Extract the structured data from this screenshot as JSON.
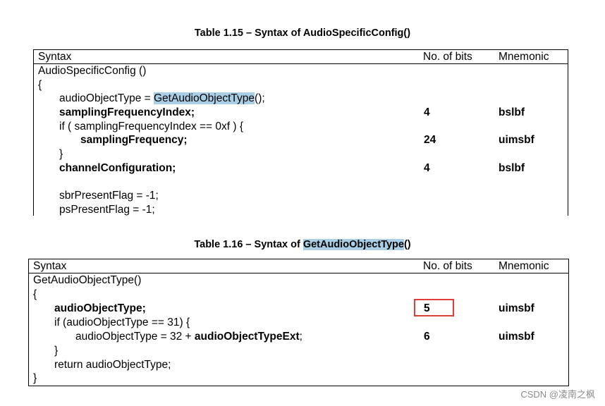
{
  "table1": {
    "caption": "Table 1.15 – Syntax of AudioSpecificConfig()",
    "headers": [
      "Syntax",
      "No. of bits",
      "Mnemonic"
    ],
    "rows": [
      {
        "syntax": "AudioSpecificConfig ()",
        "bits": "",
        "mnemonic": "",
        "bold": false
      },
      {
        "syntax": "{",
        "bits": "",
        "mnemonic": "",
        "bold": false
      },
      {
        "syntax_pre": "audioObjectType = ",
        "syntax_hl": "GetAudioObjectType",
        "syntax_post": "();",
        "bits": "",
        "mnemonic": "",
        "bold": false
      },
      {
        "syntax": "samplingFrequencyIndex;",
        "bits": "4",
        "mnemonic": "bslbf",
        "bold": true
      },
      {
        "syntax": "if ( samplingFrequencyIndex == 0xf ) {",
        "bits": "",
        "mnemonic": "",
        "bold": false
      },
      {
        "syntax": "samplingFrequency;",
        "bits": "24",
        "mnemonic": "uimsbf",
        "bold": true
      },
      {
        "syntax": "}",
        "bits": "",
        "mnemonic": "",
        "bold": false
      },
      {
        "syntax": "channelConfiguration;",
        "bits": "4",
        "mnemonic": "bslbf",
        "bold": true
      },
      {
        "syntax": "",
        "bits": "",
        "mnemonic": "",
        "bold": false
      },
      {
        "syntax": "sbrPresentFlag = -1;",
        "bits": "",
        "mnemonic": "",
        "bold": false
      },
      {
        "syntax": "psPresentFlag = -1;",
        "bits": "",
        "mnemonic": "",
        "bold": false
      }
    ]
  },
  "table2": {
    "caption_pre": "Table 1.16 – Syntax of ",
    "caption_hl": "GetAudioObjectType",
    "caption_post": "()",
    "headers": [
      "Syntax",
      "No. of bits",
      "Mnemonic"
    ],
    "rows": [
      {
        "syntax": "GetAudioObjectType()",
        "bits": "",
        "mnemonic": "",
        "bold": false
      },
      {
        "syntax": "{",
        "bits": "",
        "mnemonic": "",
        "bold": false
      },
      {
        "syntax": "audioObjectType;",
        "bits": "5",
        "mnemonic": "uimsbf",
        "bold": true,
        "highlighted_box": true
      },
      {
        "syntax": "if (audioObjectType == 31) {",
        "bits": "",
        "mnemonic": "",
        "bold": false
      },
      {
        "syntax_pre": "audioObjectType = 32 + ",
        "syntax_bold": "audioObjectTypeExt",
        "syntax_post": ";",
        "bits": "6",
        "mnemonic": "uimsbf",
        "bold": false
      },
      {
        "syntax": "}",
        "bits": "",
        "mnemonic": "",
        "bold": false
      },
      {
        "syntax": "return audioObjectType;",
        "bits": "",
        "mnemonic": "",
        "bold": false
      },
      {
        "syntax": "}",
        "bits": "",
        "mnemonic": "",
        "bold": false
      }
    ]
  },
  "annotation_color": "#e0403a",
  "highlight_color": "#a9cfe6",
  "watermark": "CSDN @凌南之枫"
}
